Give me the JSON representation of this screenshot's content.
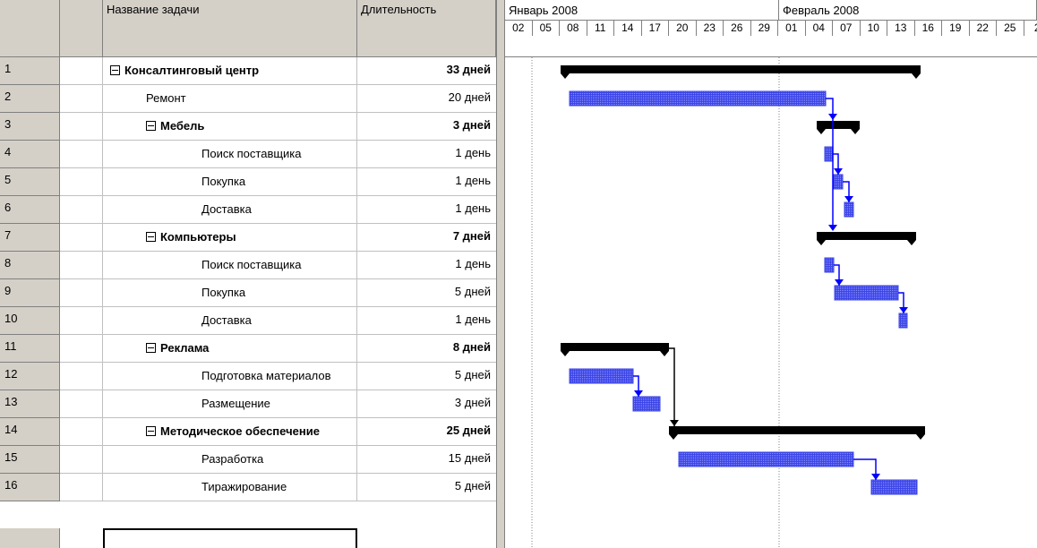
{
  "columns": {
    "name": "Название задачи",
    "duration": "Длительность"
  },
  "timeline": {
    "months": [
      "Январь 2008",
      "Февраль 2008"
    ],
    "days": [
      "02",
      "05",
      "08",
      "11",
      "14",
      "17",
      "20",
      "23",
      "26",
      "29",
      "01",
      "04",
      "07",
      "10",
      "13",
      "16",
      "19",
      "22",
      "25",
      "2"
    ]
  },
  "tasks": [
    {
      "id": "1",
      "name": "Консалтинговый центр",
      "duration": "33 дней",
      "level": 0,
      "summary": true
    },
    {
      "id": "2",
      "name": "Ремонт",
      "duration": "20 дней",
      "level": 1,
      "summary": false
    },
    {
      "id": "3",
      "name": "Мебель",
      "duration": "3 дней",
      "level": 1,
      "summary": true
    },
    {
      "id": "4",
      "name": "Поиск поставщика",
      "duration": "1 день",
      "level": 2,
      "summary": false
    },
    {
      "id": "5",
      "name": "Покупка",
      "duration": "1 день",
      "level": 2,
      "summary": false
    },
    {
      "id": "6",
      "name": "Доставка",
      "duration": "1 день",
      "level": 2,
      "summary": false
    },
    {
      "id": "7",
      "name": "Компьютеры",
      "duration": "7 дней",
      "level": 1,
      "summary": true
    },
    {
      "id": "8",
      "name": "Поиск поставщика",
      "duration": "1 день",
      "level": 2,
      "summary": false
    },
    {
      "id": "9",
      "name": "Покупка",
      "duration": "5 дней",
      "level": 2,
      "summary": false
    },
    {
      "id": "10",
      "name": "Доставка",
      "duration": "1 день",
      "level": 2,
      "summary": false
    },
    {
      "id": "11",
      "name": "Реклама",
      "duration": "8 дней",
      "level": 1,
      "summary": true
    },
    {
      "id": "12",
      "name": "Подготовка материалов",
      "duration": "5 дней",
      "level": 2,
      "summary": false
    },
    {
      "id": "13",
      "name": "Размещение",
      "duration": "3 дней",
      "level": 2,
      "summary": false
    },
    {
      "id": "14",
      "name": "Методическое обеспечение",
      "duration": "25 дней",
      "level": 1,
      "summary": true
    },
    {
      "id": "15",
      "name": "Разработка",
      "duration": "15 дней",
      "level": 2,
      "summary": false
    },
    {
      "id": "16",
      "name": "Тиражирование",
      "duration": "5 дней",
      "level": 2,
      "summary": false
    }
  ],
  "colors": {
    "summary_bar": "#000000",
    "task_bar": "#3b44e6",
    "link": "#0000ff",
    "header_bg": "#d4d0c8"
  },
  "icons": {
    "indicators": "info-icon",
    "collapse": "collapse-minus-icon"
  }
}
